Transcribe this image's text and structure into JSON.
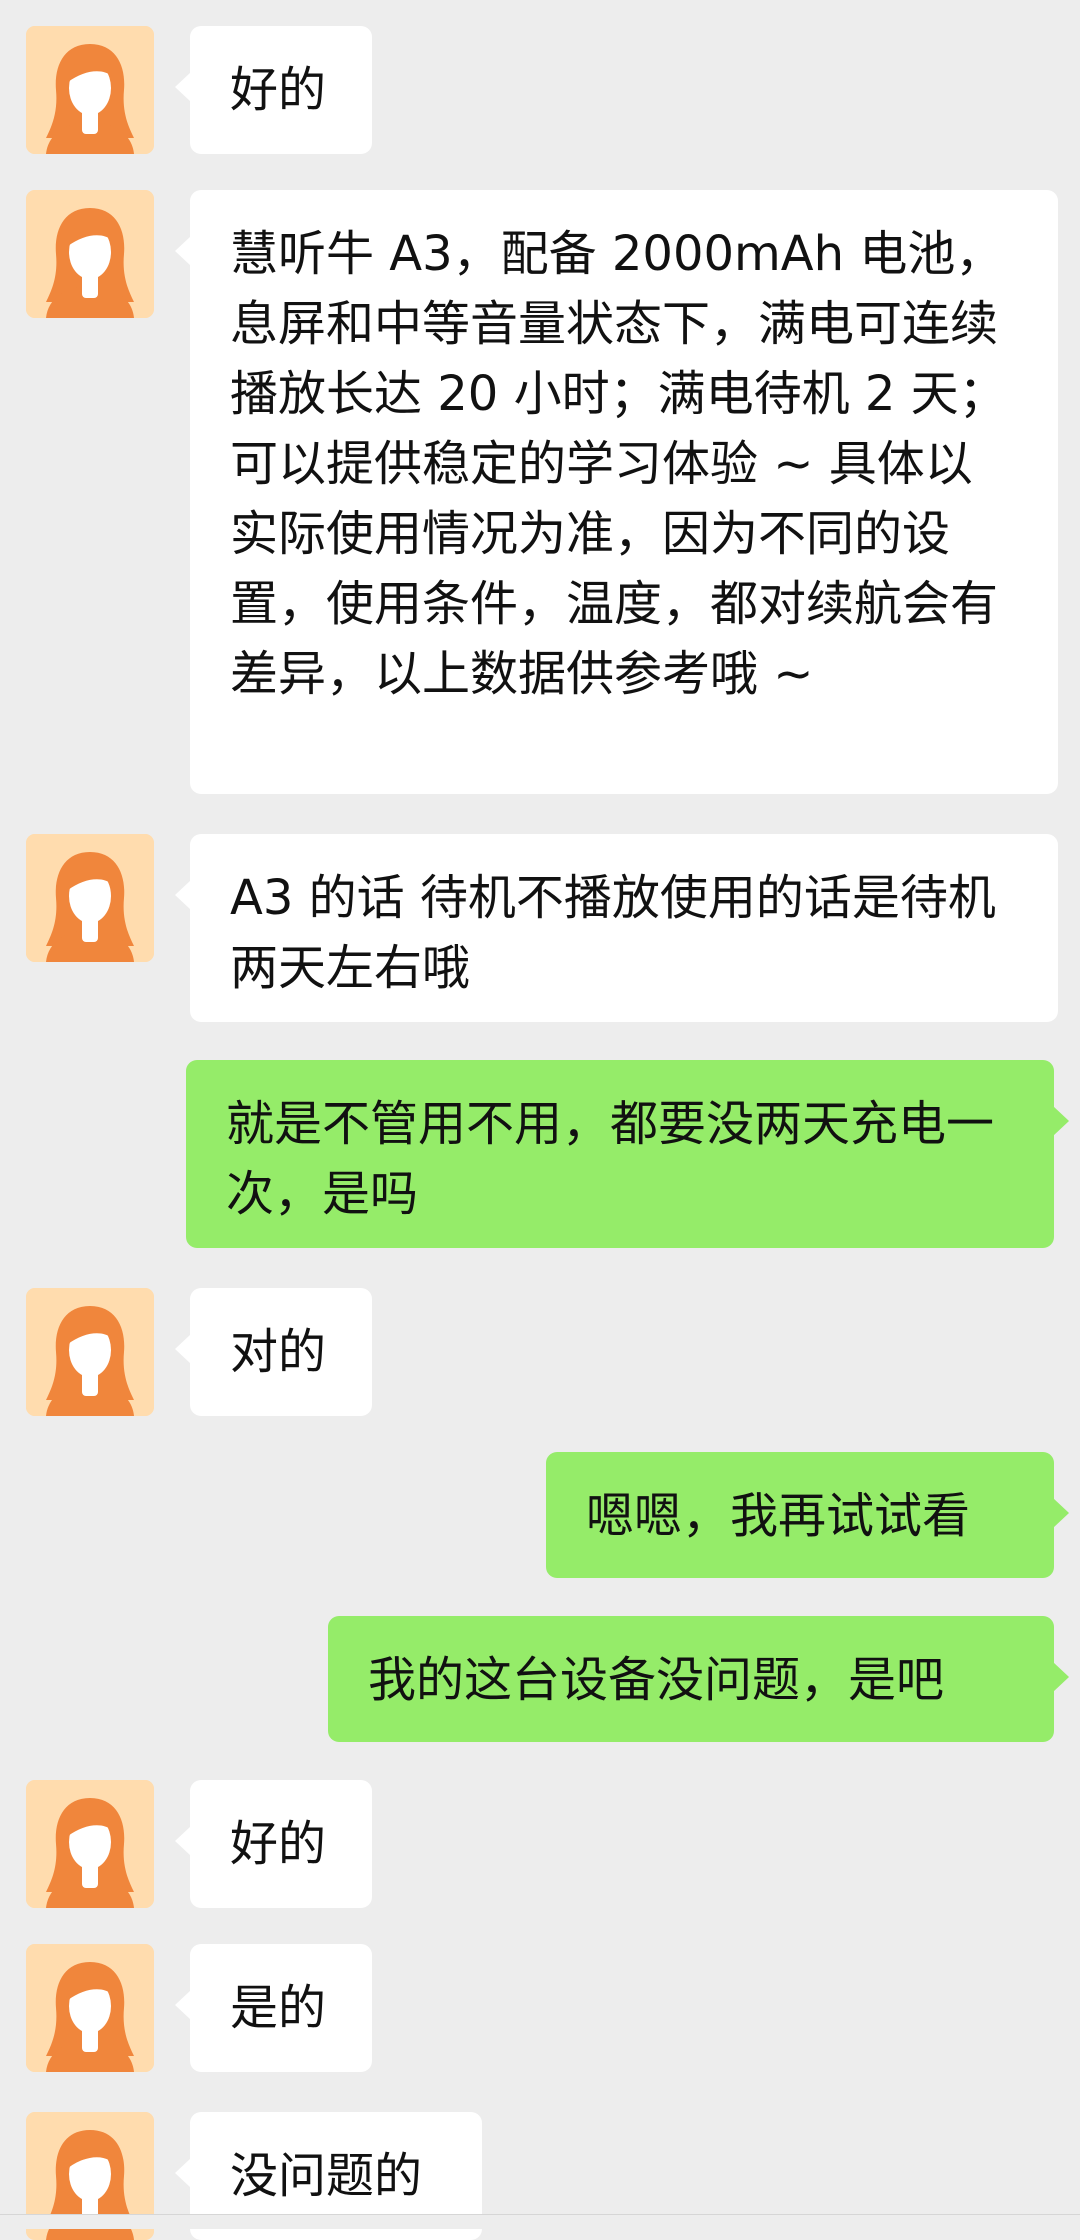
{
  "chat": {
    "messages": [
      {
        "sender": "other",
        "text": "好的"
      },
      {
        "sender": "other",
        "text": "慧听牛 A3，配备 2000mAh 电池，息屏和中等音量状态下，满电可连续播放长达 20 小时；满电待机 2 天；可以提供稳定的学习体验 ~ 具体以实际使用情况为准，因为不同的设置，使用条件，温度，都对续航会有差异，以上数据供参考哦 ~"
      },
      {
        "sender": "other",
        "text": "A3 的话 待机不播放使用的话是待机两天左右哦"
      },
      {
        "sender": "me",
        "text": "就是不管用不用，都要没两天充电一次，是吗"
      },
      {
        "sender": "other",
        "text": "对的"
      },
      {
        "sender": "me",
        "text": "嗯嗯，我再试试看"
      },
      {
        "sender": "me",
        "text": "我的这台设备没问题，是吧"
      },
      {
        "sender": "other",
        "text": "好的"
      },
      {
        "sender": "other",
        "text": "是的"
      },
      {
        "sender": "other",
        "text": "没问题的"
      }
    ]
  },
  "colors": {
    "background": "#ededed",
    "incoming_bubble": "#ffffff",
    "outgoing_bubble": "#95ec69",
    "avatar_background": "#ffdcae",
    "avatar_hair": "#f0863c"
  },
  "icons": {
    "avatar": "woman-avatar-icon"
  }
}
